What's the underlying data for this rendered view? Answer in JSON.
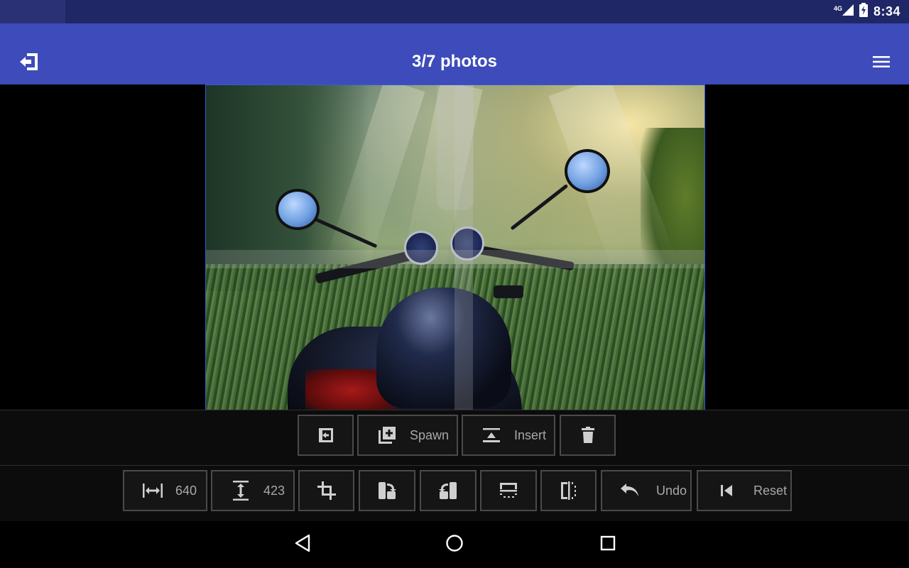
{
  "status_bar": {
    "network": "4G",
    "time": "8:34",
    "icons": [
      "signal-icon",
      "battery-charging-icon"
    ]
  },
  "app_bar": {
    "title": "3/7 photos",
    "left_icon": "exit-icon",
    "right_icon": "menu-icon"
  },
  "toolbar_top": {
    "items": [
      {
        "icon": "back-to-list-icon",
        "label": ""
      },
      {
        "icon": "spawn-icon",
        "label": "Spawn"
      },
      {
        "icon": "insert-icon",
        "label": "Insert"
      },
      {
        "icon": "delete-icon",
        "label": ""
      }
    ]
  },
  "toolbar_bottom": {
    "items": [
      {
        "icon": "width-icon",
        "label": "640"
      },
      {
        "icon": "height-icon",
        "label": "423"
      },
      {
        "icon": "crop-icon",
        "label": ""
      },
      {
        "icon": "rotate-left-icon",
        "label": ""
      },
      {
        "icon": "rotate-right-icon",
        "label": ""
      },
      {
        "icon": "flip-vertical-icon",
        "label": ""
      },
      {
        "icon": "flip-horizontal-icon",
        "label": ""
      },
      {
        "icon": "undo-icon",
        "label": "Undo"
      },
      {
        "icon": "reset-icon",
        "label": "Reset"
      }
    ]
  },
  "nav_bar": {
    "icons": [
      "back-nav-icon",
      "home-nav-icon",
      "recents-nav-icon"
    ]
  },
  "colors": {
    "status_bar": "#1f2766",
    "app_bar": "#3d4cba",
    "photo_border": "#2e5bd8",
    "toolbar_bg": "#0c0c0c",
    "button_border": "#4a4a4a"
  }
}
